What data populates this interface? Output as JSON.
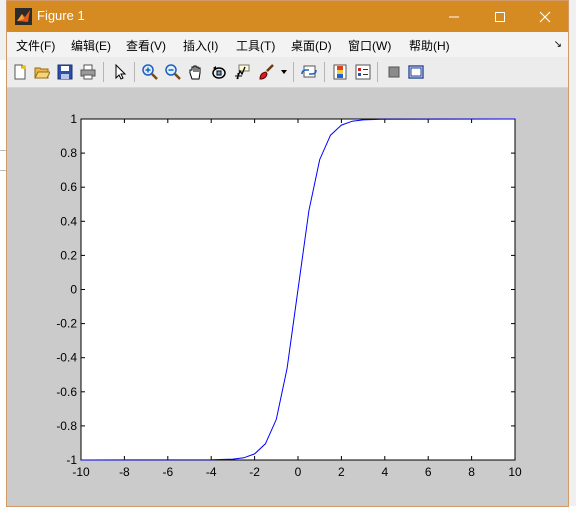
{
  "window": {
    "title": "Figure 1",
    "controls": [
      "minimize",
      "maximize",
      "close"
    ]
  },
  "menu": {
    "items": [
      "文件(F)",
      "编辑(E)",
      "查看(V)",
      "插入(I)",
      "工具(T)",
      "桌面(D)",
      "窗口(W)",
      "帮助(H)"
    ]
  },
  "toolbar": {
    "buttons": [
      "new-figure-icon",
      "open-icon",
      "save-icon",
      "print-icon",
      "select-arrow-icon",
      "zoom-in-icon",
      "zoom-out-icon",
      "pan-hand-icon",
      "rotate-3d-icon",
      "data-cursor-icon",
      "brush-icon",
      "dropdown-icon",
      "link-icon",
      "colorbar-icon",
      "legend-icon",
      "hide-tools-icon",
      "show-tools-icon"
    ]
  },
  "chart_data": {
    "type": "line",
    "title": "",
    "xlabel": "",
    "ylabel": "",
    "xlim": [
      -10,
      10
    ],
    "ylim": [
      -1,
      1
    ],
    "xticks": [
      "-10",
      "-8",
      "-6",
      "-4",
      "-2",
      "0",
      "2",
      "4",
      "6",
      "8",
      "10"
    ],
    "yticks": [
      "1",
      "0.8",
      "0.6",
      "0.4",
      "0.2",
      "0",
      "-0.2",
      "-0.4",
      "-0.6",
      "-0.8",
      "-1"
    ],
    "grid": false,
    "line_color": "#0000ff",
    "series": [
      {
        "x": [
          -10,
          -4,
          -3,
          -2.5,
          -2,
          -1.5,
          -1,
          -0.5,
          0,
          0.5,
          1,
          1.5,
          2,
          2.5,
          3,
          4,
          10
        ],
        "y": [
          -1,
          -0.999,
          -0.995,
          -0.987,
          -0.964,
          -0.905,
          -0.762,
          -0.462,
          0,
          0.462,
          0.762,
          0.905,
          0.964,
          0.987,
          0.995,
          0.999,
          1
        ]
      }
    ]
  }
}
